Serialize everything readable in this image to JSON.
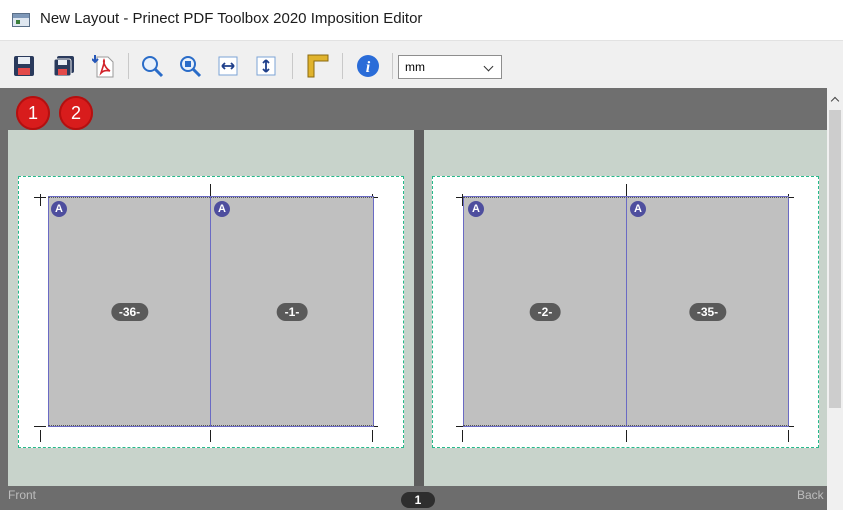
{
  "window": {
    "title": "New Layout - Prinect PDF Toolbox 2020 Imposition Editor"
  },
  "toolbar": {
    "buttons": [
      {
        "name": "save",
        "icon": "save-icon"
      },
      {
        "name": "save-as",
        "icon": "save-as-icon"
      },
      {
        "name": "export-pdf",
        "icon": "pdf-export-icon"
      },
      {
        "name": "zoom-in",
        "icon": "zoom-icon"
      },
      {
        "name": "zoom-fit",
        "icon": "zoom-fit-icon"
      },
      {
        "name": "fit-width",
        "icon": "fit-width-icon"
      },
      {
        "name": "fit-height",
        "icon": "fit-height-icon"
      },
      {
        "name": "ruler",
        "icon": "ruler-icon"
      },
      {
        "name": "info",
        "icon": "info-icon"
      }
    ],
    "unit_select": {
      "value": "mm"
    }
  },
  "sheets": {
    "badges": [
      "1",
      "2"
    ],
    "front": {
      "label": "Front",
      "pages": [
        {
          "badge": "A",
          "label": "-36-"
        },
        {
          "badge": "A",
          "label": "-1-"
        }
      ]
    },
    "back": {
      "label": "Back",
      "pages": [
        {
          "badge": "A",
          "label": "-2-"
        },
        {
          "badge": "A",
          "label": "-35-"
        }
      ]
    },
    "sheet_number": "1"
  },
  "colors": {
    "accent_badge": "#d81c1c",
    "sheet_bg": "#c8d3cb",
    "page_fill": "#c0c0c0",
    "page_border": "#6a6ac4",
    "bleed_line": "#26b98a",
    "workspace": "#6d6d6d"
  }
}
